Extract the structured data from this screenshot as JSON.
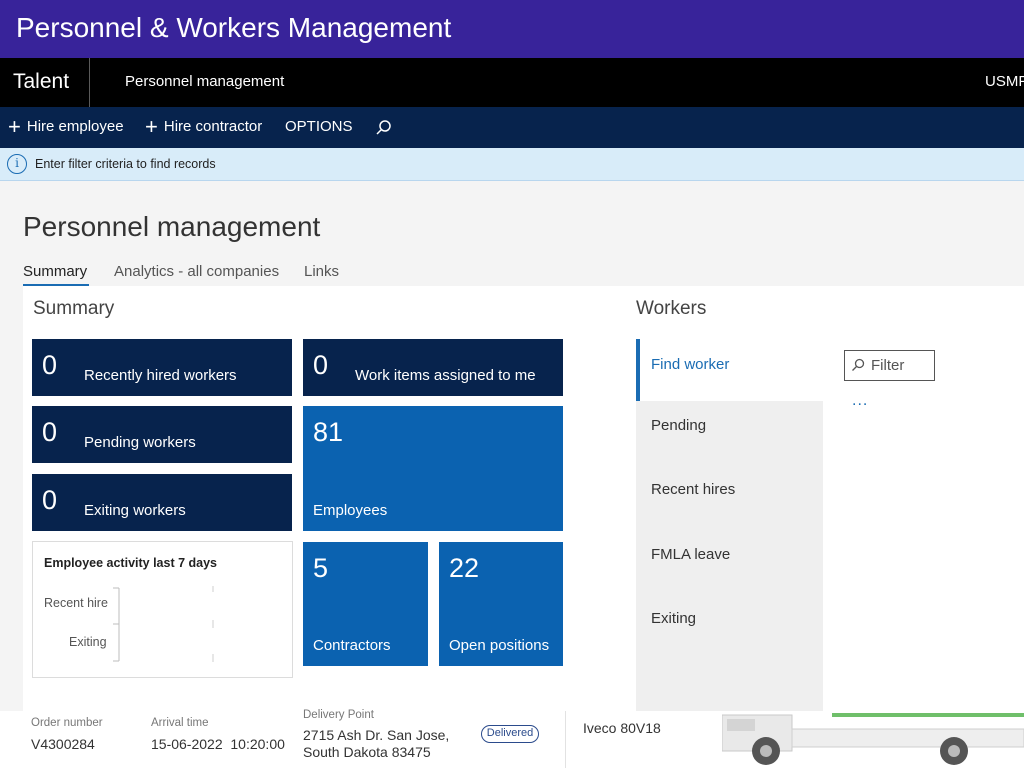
{
  "banner": {
    "title": "Personnel & Workers Management"
  },
  "appbar": {
    "app_name": "Talent",
    "module": "Personnel management",
    "company": "USMF"
  },
  "actions": {
    "hire_employee": "Hire employee",
    "hire_contractor": "Hire contractor",
    "options": "OPTIONS",
    "search_icon": "search-icon"
  },
  "infobar": {
    "icon": "info-icon",
    "message": "Enter filter criteria to find records"
  },
  "page": {
    "title": "Personnel management",
    "tabs": [
      {
        "label": "Summary",
        "active": true
      },
      {
        "label": "Analytics - all companies",
        "active": false
      },
      {
        "label": "Links",
        "active": false
      }
    ]
  },
  "summary": {
    "title": "Summary",
    "tiles": [
      {
        "count": "0",
        "label": "Recently hired workers"
      },
      {
        "count": "0",
        "label": "Work items assigned to me"
      },
      {
        "count": "0",
        "label": "Pending workers"
      },
      {
        "count": "81",
        "label": "Employees"
      },
      {
        "count": "0",
        "label": "Exiting workers"
      },
      {
        "count": "5",
        "label": "Contractors"
      },
      {
        "count": "22",
        "label": "Open positions"
      }
    ],
    "activity": {
      "title": "Employee activity last 7 days",
      "rows": [
        "Recent hire",
        "Exiting"
      ]
    }
  },
  "workers": {
    "title": "Workers",
    "nav": [
      "Find worker",
      "Pending",
      "Recent hires",
      "FMLA leave",
      "Exiting"
    ],
    "filter_placeholder": "Filter",
    "more": "..."
  },
  "order": {
    "order_label": "Order number",
    "order_value": "V4300284",
    "arrival_label": "Arrival time",
    "arrival_value": "15-06-2022  10:20:00",
    "delivery_label": "Delivery Point",
    "delivery_line1": "2715 Ash Dr. San Jose,",
    "delivery_line2": "South Dakota 83475",
    "status": "Delivered",
    "vehicle": "Iveco 80V18"
  },
  "colors": {
    "banner": "#38239a",
    "dark_tile": "#07234d",
    "blue_tile": "#0b62b0",
    "accent": "#1a6cb3"
  }
}
